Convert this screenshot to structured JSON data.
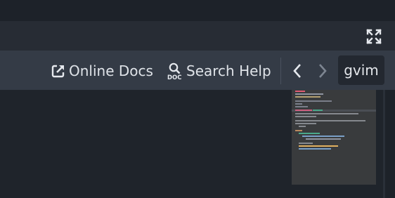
{
  "toolbar": {
    "online_docs_label": "Online Docs",
    "search_help_label": "Search Help",
    "search_label": "gvim"
  },
  "icons": {
    "fullscreen": "expand-arrows-icon",
    "online_docs": "external-link-icon",
    "search_help": "doc-search-icon",
    "back": "chevron-left-icon",
    "forward": "chevron-right-icon"
  },
  "colors": {
    "background": "#1d2229",
    "toolbar": "#343b46",
    "minimap": "#393b3d",
    "text": "#dfe3e8"
  }
}
